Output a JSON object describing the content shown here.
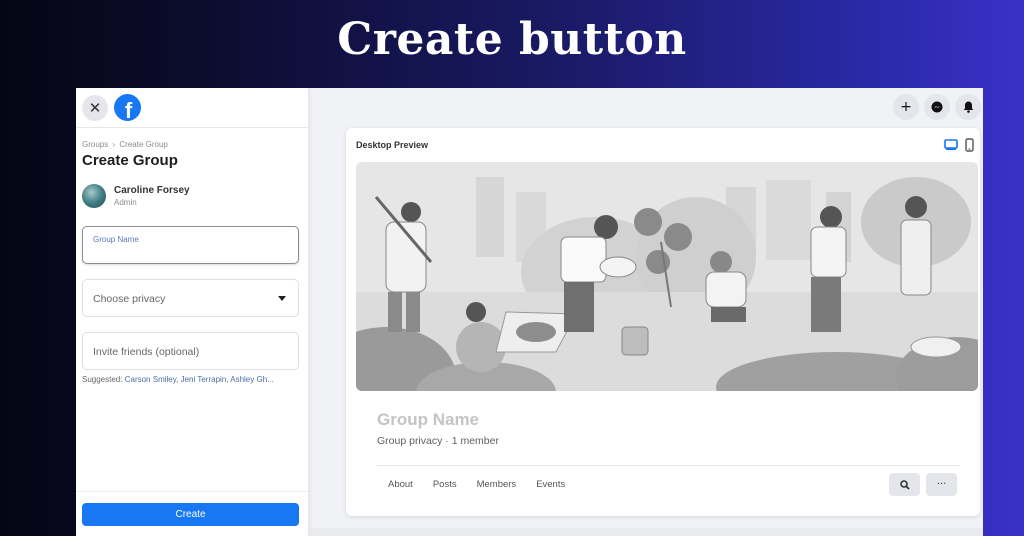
{
  "banner": {
    "title": "Create button"
  },
  "colors": {
    "accent": "#1877f2",
    "banner_start": "#050514",
    "banner_end": "#3a30c8"
  },
  "sidebar": {
    "close_icon": "close-icon",
    "logo": "facebook-logo",
    "logo_glyph": "f",
    "close_glyph": "✕",
    "breadcrumb": {
      "parent": "Groups",
      "separator": "›",
      "current": "Create Group"
    },
    "title": "Create Group",
    "user": {
      "name": "Caroline Forsey",
      "role": "Admin"
    },
    "group_name_field": {
      "label": "Group Name",
      "value": ""
    },
    "privacy_select": {
      "placeholder": "Choose privacy"
    },
    "invite_field": {
      "placeholder": "Invite friends (optional)"
    },
    "suggested": {
      "label": "Suggested:",
      "names": "Carson Smiley, Jeni Terrapin, Ashley Gh..."
    },
    "create_button": "Create"
  },
  "topbar": {
    "icons": [
      {
        "name": "plus-icon",
        "glyph": "+"
      },
      {
        "name": "messenger-icon",
        "glyph": ""
      },
      {
        "name": "notifications-icon",
        "glyph": ""
      }
    ]
  },
  "preview": {
    "title": "Desktop Preview",
    "devices": [
      "desktop",
      "mobile"
    ],
    "active_device": "desktop",
    "cover_alt": "Illustration of people gardening in a park",
    "group_name": "Group Name",
    "group_meta": "Group privacy · 1 member",
    "tabs": [
      "About",
      "Posts",
      "Members",
      "Events"
    ],
    "search_glyph": "🔍",
    "more_glyph": "···"
  }
}
